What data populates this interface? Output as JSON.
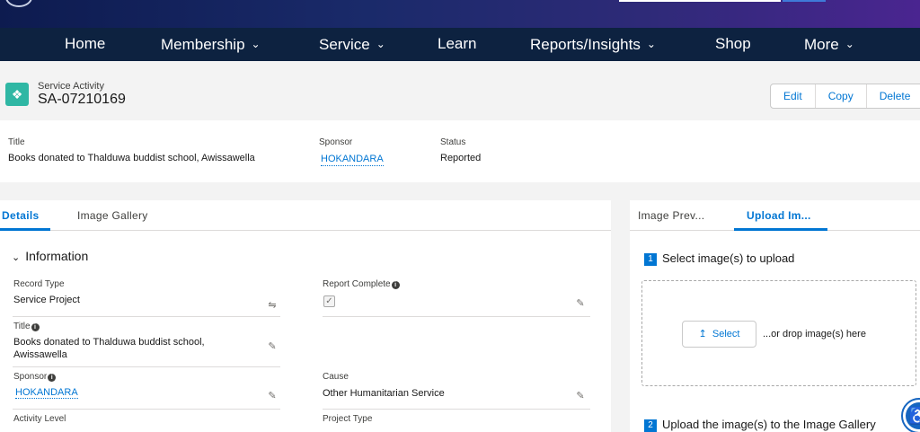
{
  "nav": {
    "items": [
      {
        "label": "Home",
        "has_menu": false
      },
      {
        "label": "Membership",
        "has_menu": true
      },
      {
        "label": "Service",
        "has_menu": true
      },
      {
        "label": "Learn",
        "has_menu": false
      },
      {
        "label": "Reports/Insights",
        "has_menu": true
      },
      {
        "label": "Shop",
        "has_menu": false
      },
      {
        "label": "More",
        "has_menu": true
      }
    ]
  },
  "record": {
    "object_type": "Service Activity",
    "id": "SA-07210169",
    "actions": [
      "Edit",
      "Copy",
      "Delete"
    ]
  },
  "highlights": {
    "title_label": "Title",
    "title_value": "Books donated to Thalduwa buddist school, Awissawella",
    "sponsor_label": "Sponsor",
    "sponsor_value": "HOKANDARA",
    "status_label": "Status",
    "status_value": "Reported"
  },
  "left_tabs": {
    "details": "Details",
    "gallery": "Image Gallery"
  },
  "information": {
    "section_title": "Information",
    "record_type_label": "Record Type",
    "record_type_value": "Service Project",
    "report_complete_label": "Report Complete",
    "report_complete_checked": true,
    "title_label": "Title",
    "title_value": "Books donated to Thalduwa buddist school, Awissawella",
    "sponsor_label": "Sponsor",
    "sponsor_value": "HOKANDARA",
    "cause_label": "Cause",
    "cause_value": "Other Humanitarian Service",
    "activity_level_label": "Activity Level",
    "project_type_label": "Project Type"
  },
  "right_tabs": {
    "preview": "Image Prev...",
    "upload": "Upload Im..."
  },
  "upload": {
    "step1_num": "1",
    "step1_title": "Select image(s) to upload",
    "select_label": "Select",
    "drop_text": "...or drop image(s) here",
    "step2_num": "2",
    "step2_title": "Upload the image(s) to the Image Gallery"
  },
  "colors": {
    "nav_bg": "#0d2240",
    "accent": "#0176d3",
    "record_icon": "#2fb7a4"
  }
}
